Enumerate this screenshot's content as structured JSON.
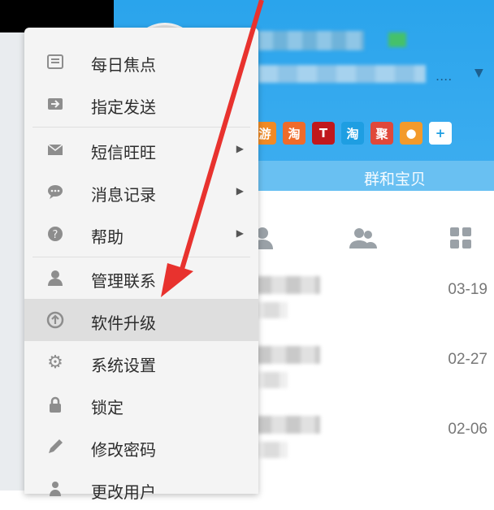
{
  "menu": {
    "items": [
      {
        "label": "每日焦点",
        "icon": "newspaper-icon",
        "has_submenu": false,
        "active": false
      },
      {
        "label": "指定发送",
        "icon": "send-arrow-icon",
        "has_submenu": false,
        "active": false
      },
      {
        "label": "短信旺旺",
        "icon": "envelope-icon",
        "has_submenu": true,
        "active": false
      },
      {
        "label": "消息记录",
        "icon": "chat-bubble-icon",
        "has_submenu": true,
        "active": false
      },
      {
        "label": "帮助",
        "icon": "question-circle-icon",
        "has_submenu": true,
        "active": false
      },
      {
        "label": "管理联系",
        "icon": "person-icon",
        "has_submenu": false,
        "active": false
      },
      {
        "label": "软件升级",
        "icon": "upgrade-circle-icon",
        "has_submenu": false,
        "active": true
      },
      {
        "label": "系统设置",
        "icon": "gear-icon",
        "has_submenu": false,
        "active": false
      },
      {
        "label": "锁定",
        "icon": "lock-icon",
        "has_submenu": false,
        "active": false
      },
      {
        "label": "修改密码",
        "icon": "pencil-icon",
        "has_submenu": false,
        "active": false
      },
      {
        "label": "更改用户",
        "icon": "user-switch-icon",
        "has_submenu": false,
        "active": false
      }
    ]
  },
  "header": {
    "dots": "....",
    "search_fragment": "群和宝贝",
    "apps": [
      {
        "label": "游",
        "color": "#f08a24"
      },
      {
        "label": "淘",
        "color": "#ef6b2a"
      },
      {
        "label": "T",
        "color": "#c0181d"
      },
      {
        "label": "淘",
        "color": "#1e9ee2"
      },
      {
        "label": "聚",
        "color": "#e0483a"
      },
      {
        "label": "●",
        "color": "#f39a2b"
      },
      {
        "label": "+",
        "color": "#ffffff"
      }
    ]
  },
  "list": {
    "rows": [
      {
        "prefix": "系统",
        "date": "03-19"
      },
      {
        "prefix": "温馨",
        "date": "02-27"
      },
      {
        "prefix": "欧臣",
        "date": "02-06"
      }
    ]
  },
  "colors": {
    "header_blue": "#2aa4ec",
    "arrow_red": "#e8322e",
    "menu_bg": "#f4f4f4",
    "menu_active": "#dedede"
  }
}
